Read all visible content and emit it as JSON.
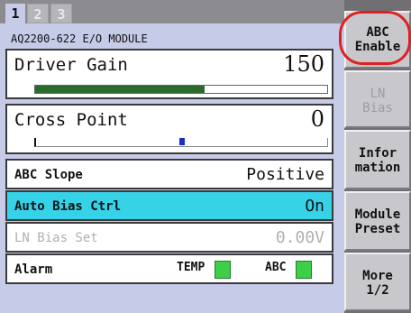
{
  "tabs": [
    "1",
    "2",
    "3"
  ],
  "module_title": "AQ2200-622 E/O MODULE",
  "driver_gain": {
    "label": "Driver Gain",
    "value": "150",
    "bar_fraction": 0.58
  },
  "cross_point": {
    "label": "Cross Point",
    "value": "0",
    "marker_fraction": 0.5
  },
  "rows": {
    "abc_slope": {
      "label": "ABC Slope",
      "value": "Positive"
    },
    "auto_bias": {
      "label": "Auto Bias Ctrl",
      "value": "On"
    },
    "ln_bias_set": {
      "label": "LN Bias Set",
      "value": "0.00V"
    },
    "alarm": {
      "label": "Alarm",
      "temp_label": "TEMP",
      "abc_label": "ABC"
    }
  },
  "softkeys": {
    "abc_enable": {
      "l1": "ABC",
      "l2": "Enable"
    },
    "ln_bias": {
      "l1": "LN",
      "l2": "Bias"
    },
    "information": {
      "l1": "Infor",
      "l2": "mation"
    },
    "module_preset": {
      "l1": "Module",
      "l2": "Preset"
    },
    "more": {
      "l1": "More",
      "l2": "1/2"
    }
  },
  "colors": {
    "screen_bg": "#c6cbe8",
    "selected_row": "#36d2e8",
    "gain_bar": "#2a6b2c",
    "cross_marker": "#1a2fc8",
    "led_ok": "#3cd048",
    "highlight_ring": "#e02020"
  }
}
